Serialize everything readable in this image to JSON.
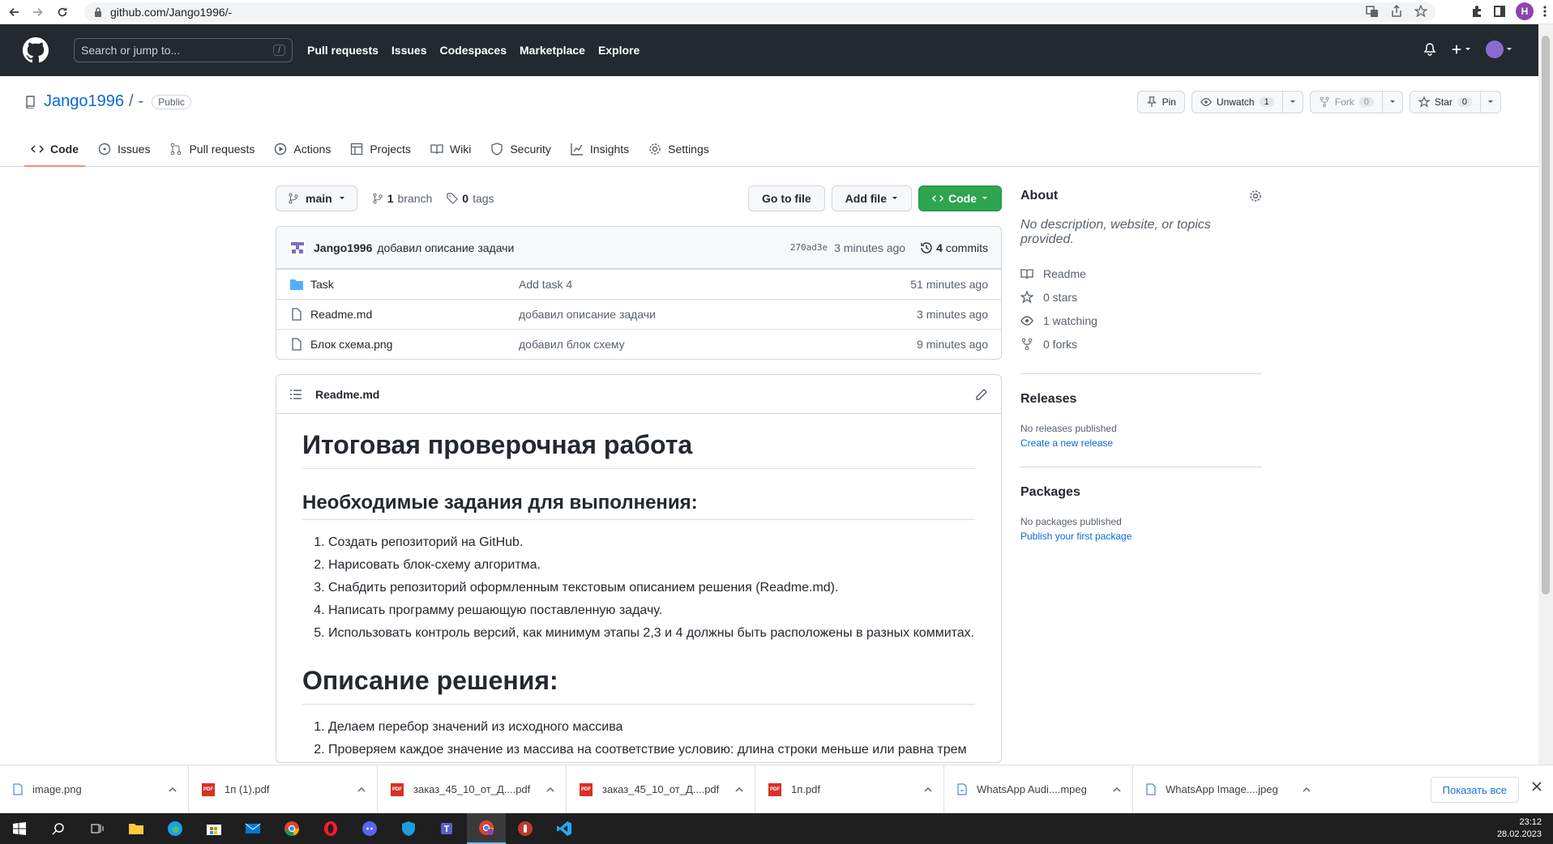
{
  "browser": {
    "url": "github.com/Jango1996/-",
    "profile_initial": "H"
  },
  "header": {
    "search_placeholder": "Search or jump to...",
    "search_shortcut": "/",
    "nav": [
      "Pull requests",
      "Issues",
      "Codespaces",
      "Marketplace",
      "Explore"
    ]
  },
  "repo": {
    "owner": "Jango1996",
    "separator": "/",
    "name": "-",
    "visibility": "Public",
    "pin_label": "Pin",
    "unwatch_label": "Unwatch",
    "watch_count": "1",
    "fork_label": "Fork",
    "fork_count": "0",
    "star_label": "Star",
    "star_count": "0",
    "tabs": [
      "Code",
      "Issues",
      "Pull requests",
      "Actions",
      "Projects",
      "Wiki",
      "Security",
      "Insights",
      "Settings"
    ]
  },
  "toolbar": {
    "branch": "main",
    "branch_count": "1",
    "branch_label": "branch",
    "tag_count": "0",
    "tag_label": "tags",
    "go_to_file": "Go to file",
    "add_file": "Add file",
    "code": "Code"
  },
  "commit": {
    "author": "Jango1996",
    "message": "добавил описание задачи",
    "sha": "270ad3e",
    "time": "3 minutes ago",
    "commits_count": "4",
    "commits_label": "commits"
  },
  "files": [
    {
      "name": "Task",
      "type": "folder",
      "message": "Add task 4",
      "time": "51 minutes ago"
    },
    {
      "name": "Readme.md",
      "type": "file",
      "message": "добавил описание задачи",
      "time": "3 minutes ago"
    },
    {
      "name": "Блок схема.png",
      "type": "file",
      "message": "добавил блок схему",
      "time": "9 minutes ago"
    }
  ],
  "readme": {
    "filename": "Readme.md",
    "h1": "Итоговая проверочная работа",
    "h2_tasks": "Необходимые задания для выполнения:",
    "tasks": [
      "Создать репозиторий на GitHub.",
      "Нарисовать блок-схему алгоритма.",
      "Снабдить репозиторий оформленным текстовым описанием решения (Readme.md).",
      "Написать программу решающую поставленную задачу.",
      "Использовать контроль версий, как минимум этапы 2,3 и 4 должны быть расположены в разных коммитах."
    ],
    "h1_solution": "Описание решения:",
    "solution": [
      "Делаем перебор значений из исходного массива",
      "Проверяем каждое значение из массива на соответствие условию: длина строки меньше или равна трем"
    ]
  },
  "sidebar": {
    "about_title": "About",
    "about_desc": "No description, website, or topics provided.",
    "readme_label": "Readme",
    "stars": "0 stars",
    "watching": "1 watching",
    "forks": "0 forks",
    "releases_title": "Releases",
    "releases_none": "No releases published",
    "releases_link": "Create a new release",
    "packages_title": "Packages",
    "packages_none": "No packages published",
    "packages_link": "Publish your first package"
  },
  "downloads": {
    "items": [
      {
        "name": "image.png",
        "icon": "image-file-icon"
      },
      {
        "name": "1п (1).pdf",
        "icon": "pdf-icon"
      },
      {
        "name": "заказ_45_10_от_Д....pdf",
        "icon": "pdf-icon"
      },
      {
        "name": "заказ_45_10_от_Д....pdf",
        "icon": "pdf-icon"
      },
      {
        "name": "1п.pdf",
        "icon": "pdf-icon"
      },
      {
        "name": "WhatsApp Audi....mpeg",
        "icon": "audio-file-icon"
      },
      {
        "name": "WhatsApp Image....jpeg",
        "icon": "image-file-icon"
      }
    ],
    "show_all": "Показать все"
  },
  "taskbar": {
    "time": "23:12",
    "date": "28.02.2023"
  },
  "colors": {
    "header_bg": "#24292f",
    "link": "#0969da",
    "green_button": "#2da44e",
    "tab_underline": "#fd8c73"
  }
}
